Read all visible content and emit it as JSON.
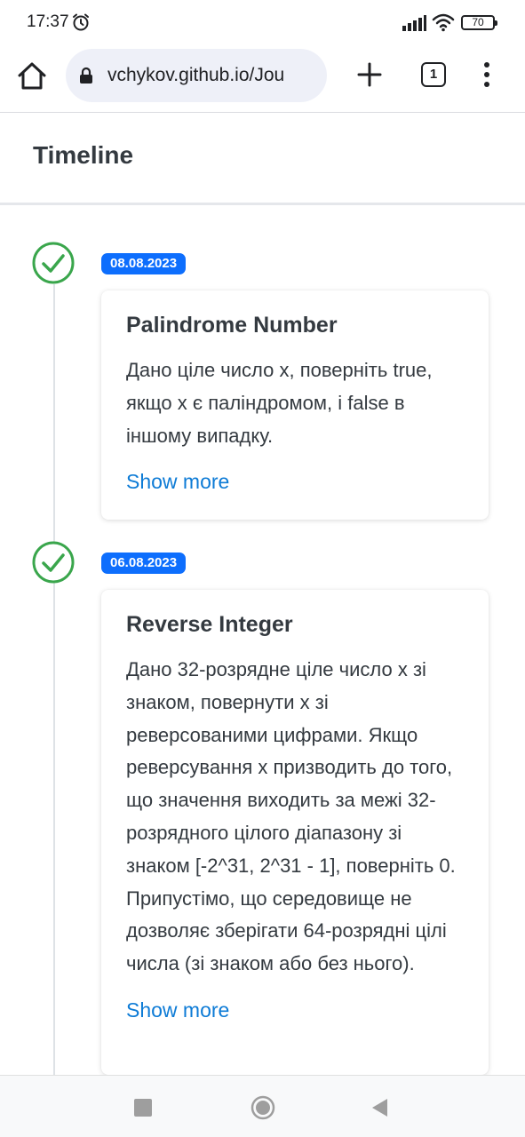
{
  "status_bar": {
    "time": "17:37",
    "battery": "70",
    "icons": [
      "alarm-icon",
      "signal-icon",
      "wifi-icon",
      "battery-icon"
    ]
  },
  "browser": {
    "url": "vchykov.github.io/Jou",
    "tab_count": "1",
    "icons": [
      "home-icon",
      "lock-icon",
      "plus-icon",
      "menu-icon"
    ]
  },
  "page": {
    "title": "Timeline"
  },
  "timeline": [
    {
      "date": "08.08.2023",
      "title": "Palindrome Number",
      "text": "Дано ціле число x, поверніть true, якщо x є паліндромом, і false в іншому випадку.",
      "link": "Show more",
      "status_icon": "check-circle-icon"
    },
    {
      "date": "06.08.2023",
      "title": "Reverse Integer",
      "text": "Дано 32-розрядне ціле число x зі знаком, повернути x зі реверсованими цифрами. Якщо реверсування x призводить до того, що значення виходить за межі 32-розрядного цілого діапазону зі знаком [-2^31, 2^31 - 1], поверніть 0. Припустімо, що середовище не дозволяє зберігати 64-розрядні цілі числа (зі знаком або без нього).",
      "link": "Show more",
      "status_icon": "check-circle-icon"
    }
  ],
  "colors": {
    "badge": "#0d6efd",
    "check": "#3aa64c",
    "link": "#0d7bd6",
    "url_bar": "#eef0f8"
  }
}
